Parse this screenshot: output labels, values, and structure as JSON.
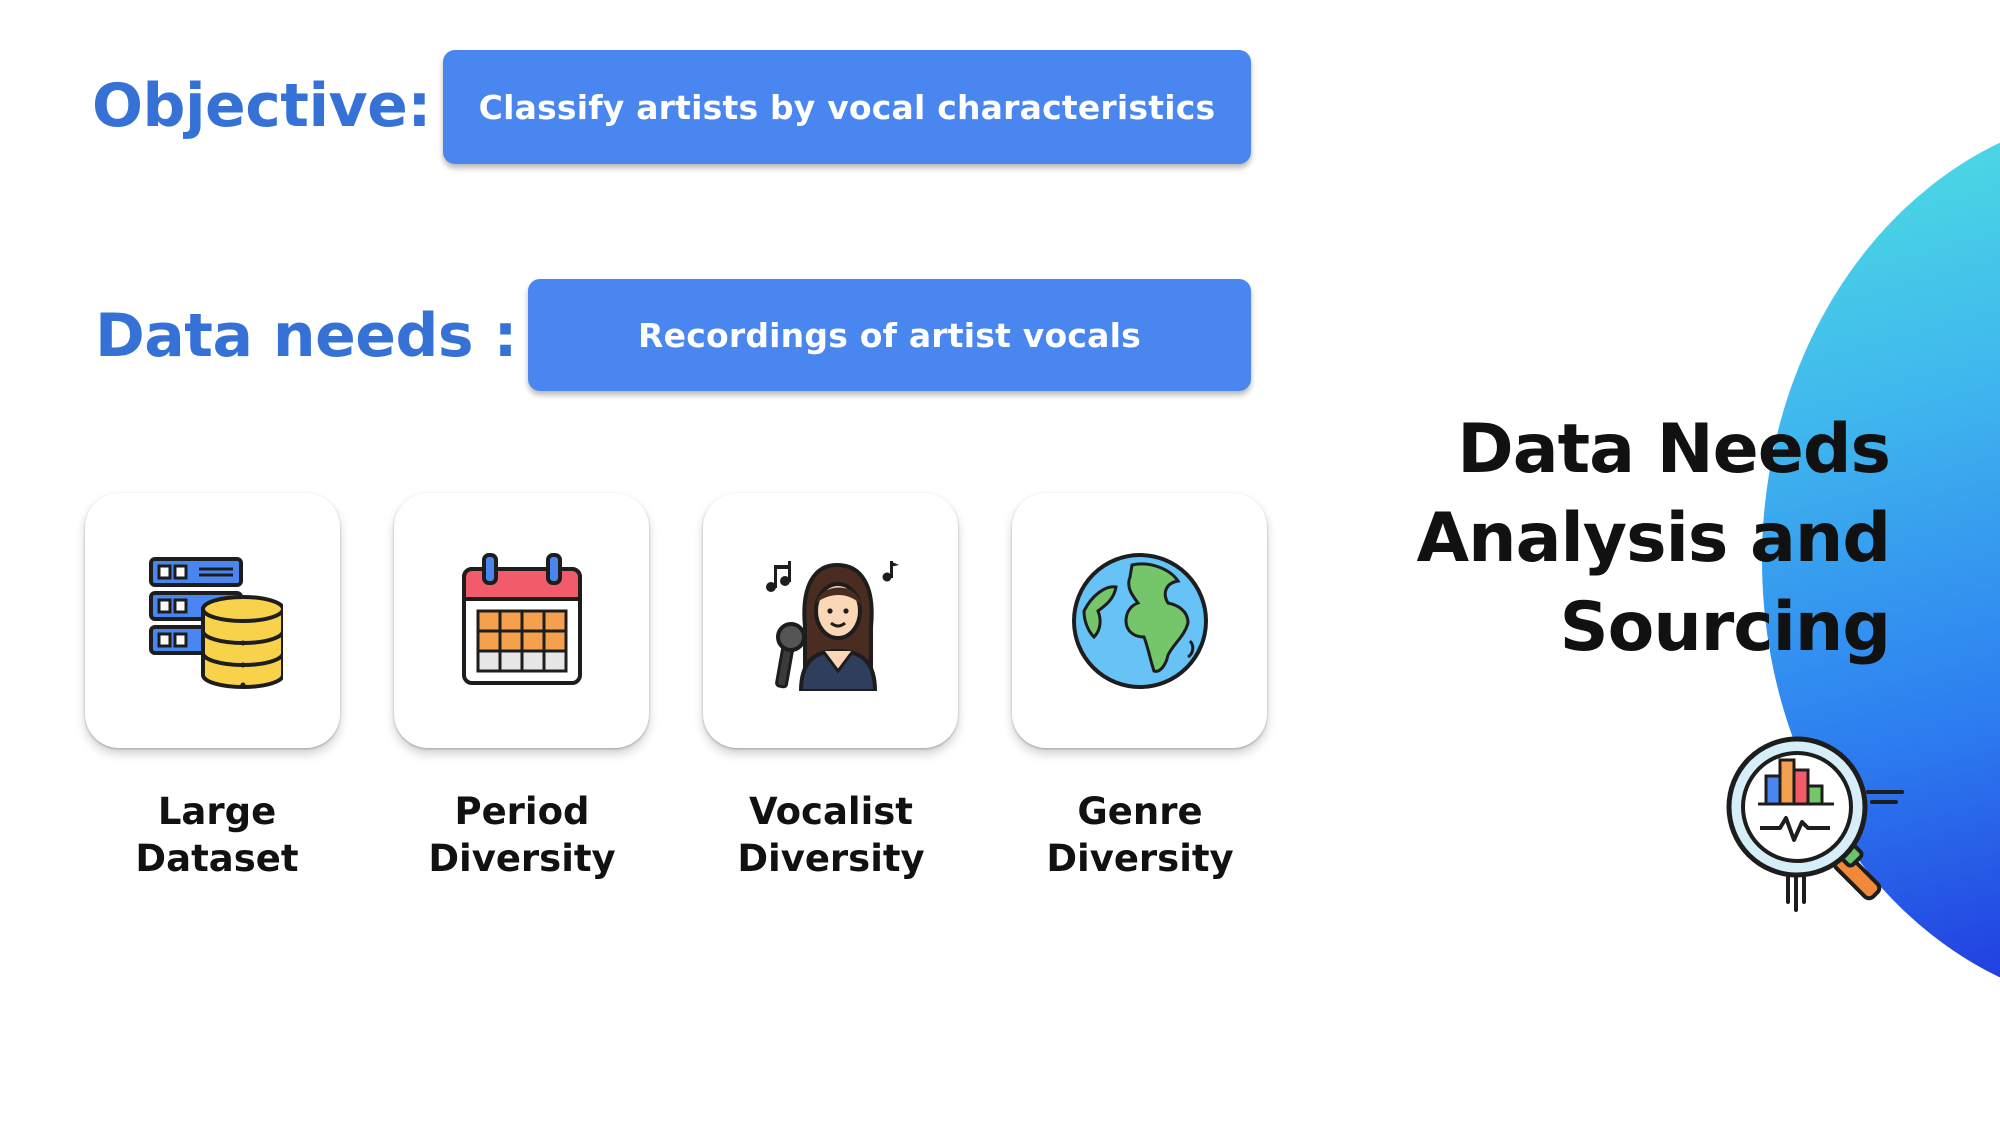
{
  "objective": {
    "label": "Objective:",
    "value": "Classify artists by vocal characteristics"
  },
  "data_needs": {
    "label": "Data needs :",
    "value": "Recordings of artist vocals"
  },
  "cards": [
    {
      "icon": "database-icon",
      "line1": "Large",
      "line2": "Dataset"
    },
    {
      "icon": "calendar-icon",
      "line1": "Period",
      "line2": "Diversity"
    },
    {
      "icon": "singer-icon",
      "line1": "Vocalist",
      "line2": "Diversity"
    },
    {
      "icon": "globe-icon",
      "line1": "Genre",
      "line2": "Diversity"
    }
  ],
  "side_title": {
    "line1": "Data Needs",
    "line2": "Analysis and",
    "line3": "Sourcing"
  },
  "side_icon": "magnifier-chart-icon",
  "colors": {
    "label_blue": "#3672d6",
    "pill_blue": "#4a86f0",
    "gradient_start": "#4fe3e0",
    "gradient_end": "#1b17d6"
  }
}
